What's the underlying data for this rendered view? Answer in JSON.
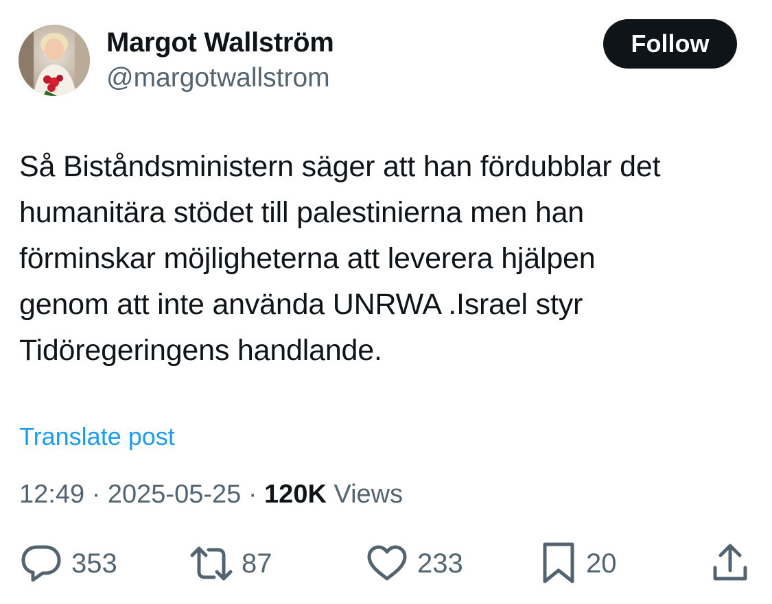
{
  "author": {
    "display_name": "Margot Wallström",
    "handle": "@margotwallstrom",
    "avatar": "profile-photo"
  },
  "follow_label": "Follow",
  "tweet": {
    "lines": [
      "Så Biståndsministern säger att han fördubblar det",
      "humanitära stödet till palestinierna men han",
      "förminskar möjligheterna att leverera hjälpen",
      "genom att inte använda UNRWA .Israel styr",
      "Tidöregeringens handlande."
    ]
  },
  "translate_label": "Translate post",
  "meta": {
    "time": "12:49",
    "separator": " · ",
    "date": "2025-05-25",
    "views_count": "120K",
    "views_label": " Views"
  },
  "actions": {
    "reply": {
      "icon": "reply-bubble-icon",
      "count": "353"
    },
    "repost": {
      "icon": "repost-arrows-icon",
      "count": "87"
    },
    "like": {
      "icon": "heart-icon",
      "count": "233"
    },
    "bookmark": {
      "icon": "bookmark-icon",
      "count": "20"
    },
    "share": {
      "icon": "share-upload-icon"
    }
  },
  "colors": {
    "text": "#0f1419",
    "secondary": "#536471",
    "link": "#1d9bf0",
    "follow_bg": "#0f1419"
  }
}
